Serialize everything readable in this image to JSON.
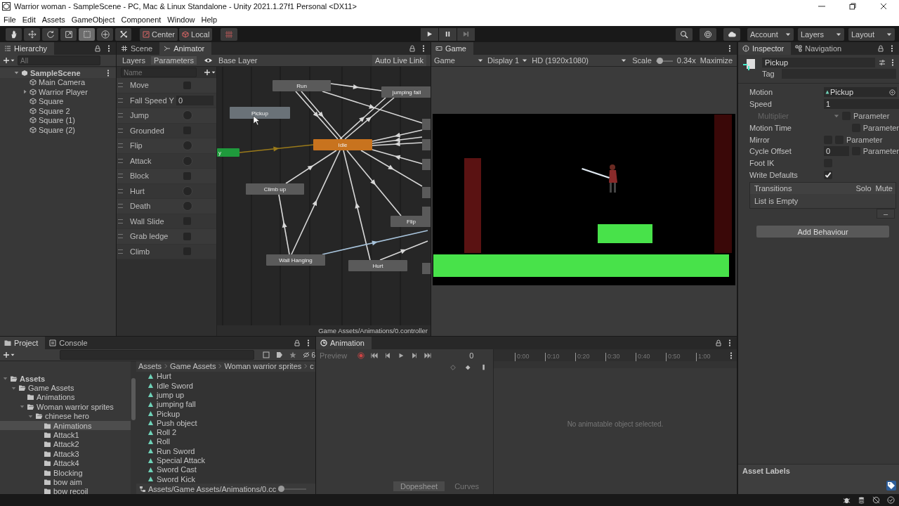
{
  "window": {
    "title": "Warrior woman - SampleScene - PC, Mac & Linux Standalone - Unity 2021.1.27f1 Personal <DX11>"
  },
  "menu": [
    "File",
    "Edit",
    "Assets",
    "GameObject",
    "Component",
    "Window",
    "Help"
  ],
  "toolbar": {
    "tools": [
      {
        "kind": "hand",
        "selected": false
      },
      {
        "kind": "move",
        "selected": false
      },
      {
        "kind": "rotate",
        "selected": false
      },
      {
        "kind": "scale",
        "selected": false
      },
      {
        "kind": "rect",
        "selected": true
      },
      {
        "kind": "transform",
        "selected": false
      },
      {
        "kind": "custom",
        "selected": false
      }
    ],
    "pivot": [
      "Center",
      "Local"
    ],
    "menus": [
      "Account",
      "Layers",
      "Layout"
    ]
  },
  "hierarchy": {
    "tab": "Hierarchy",
    "search": {
      "placeholder": "All"
    },
    "tree": [
      {
        "label": "SampleScene",
        "kind": "scene",
        "expanded": true,
        "children": [
          {
            "label": "Main Camera",
            "kind": "object"
          },
          {
            "label": "Warrior Player",
            "kind": "object",
            "expanded": false
          },
          {
            "label": "Square",
            "kind": "object"
          },
          {
            "label": "Square 2",
            "kind": "object"
          },
          {
            "label": "Square (1)",
            "kind": "object"
          },
          {
            "label": "Square (2)",
            "kind": "object"
          }
        ]
      }
    ]
  },
  "animator": {
    "tabs": [
      {
        "label": "Scene",
        "kind": "scene",
        "selected": false
      },
      {
        "label": "Animator",
        "kind": "animator",
        "selected": true
      }
    ],
    "view_tabs": [
      {
        "label": "Layers",
        "selected": false
      },
      {
        "label": "Parameters",
        "selected": true
      }
    ],
    "layer": "Base Layer",
    "live_link": "Auto Live Link",
    "search": {
      "placeholder": "Name"
    },
    "parameters": [
      {
        "name": "Move",
        "kind": "bool",
        "checked": false
      },
      {
        "name": "Fall Speed Y",
        "kind": "float",
        "value": "0"
      },
      {
        "name": "Jump",
        "kind": "trigger",
        "on": false
      },
      {
        "name": "Grounded",
        "kind": "bool",
        "checked": false
      },
      {
        "name": "Flip",
        "kind": "trigger",
        "on": false
      },
      {
        "name": "Attack",
        "kind": "trigger",
        "on": false
      },
      {
        "name": "Block",
        "kind": "bool",
        "checked": false
      },
      {
        "name": "Hurt",
        "kind": "trigger",
        "on": false
      },
      {
        "name": "Death",
        "kind": "trigger",
        "on": false
      },
      {
        "name": "Wall Slide",
        "kind": "bool",
        "checked": false
      },
      {
        "name": "Grab ledge",
        "kind": "bool",
        "checked": false
      },
      {
        "name": "Climb",
        "kind": "bool",
        "checked": false
      }
    ],
    "states": [
      {
        "label": "Run",
        "kind": "state"
      },
      {
        "label": "jumping fall",
        "kind": "state"
      },
      {
        "label": "Pickup",
        "kind": "selected"
      },
      {
        "label": "Idle",
        "kind": "default"
      },
      {
        "label": "y",
        "kind": "entry"
      },
      {
        "label": "Climb up",
        "kind": "state"
      },
      {
        "label": "Wall Hanging",
        "kind": "state"
      },
      {
        "label": "Hurt",
        "kind": "state"
      },
      {
        "label": "Flip",
        "kind": "state"
      }
    ],
    "footer": "Game Assets/Animations/0.controller"
  },
  "game": {
    "tab": "Game",
    "view": "Game",
    "display": "Display 1",
    "resolution": "HD (1920x1080)",
    "scale_label": "Scale",
    "scale": {
      "level": 0.05
    },
    "scale_value": "0.34x",
    "maximize": "Maximize"
  },
  "inspector": {
    "tabs": [
      {
        "label": "Inspector",
        "kind": "info",
        "selected": true
      },
      {
        "label": "Navigation",
        "kind": "nav",
        "selected": false
      }
    ],
    "name": "Pickup",
    "tag_label": "Tag",
    "properties": [
      {
        "label": "Motion",
        "kind": "object",
        "value": "Pickup",
        "disabled": false
      },
      {
        "label": "Speed",
        "kind": "text",
        "value": "1",
        "disabled": false
      },
      {
        "label": "Multiplier",
        "kind": "dropdown",
        "disabled": true,
        "param": {
          "label": "Parameter",
          "checked": false
        }
      },
      {
        "label": "Motion Time",
        "kind": "none",
        "disabled": false,
        "param": {
          "label": "Parameter",
          "checked": false
        }
      },
      {
        "label": "Mirror",
        "kind": "checkbox",
        "checked": false,
        "disabled": false,
        "param": {
          "label": "Parameter",
          "checked": false
        }
      },
      {
        "label": "Cycle Offset",
        "kind": "text",
        "value": "0",
        "disabled": false,
        "param": {
          "label": "Parameter",
          "checked": false
        }
      },
      {
        "label": "Foot IK",
        "kind": "checkbox",
        "checked": false,
        "disabled": false
      },
      {
        "label": "Write Defaults",
        "kind": "checkbox",
        "checked": true,
        "disabled": false
      }
    ],
    "transitions": {
      "title": "Transitions",
      "columns": [
        "Solo",
        "Mute"
      ],
      "empty": "List is Empty",
      "remove": "–"
    },
    "add_button": "Add Behaviour",
    "asset_labels": "Asset Labels"
  },
  "project": {
    "tabs": [
      {
        "label": "Project",
        "kind": "project",
        "selected": true
      },
      {
        "label": "Console",
        "kind": "console",
        "selected": false
      }
    ],
    "hidden_count": "6",
    "tree": [
      {
        "label": "Assets",
        "selected": false,
        "expanded": true,
        "children": [
          {
            "label": "Game Assets",
            "selected": false,
            "expanded": true,
            "children": [
              {
                "label": "Animations",
                "selected": false
              },
              {
                "label": "Woman warrior sprites",
                "selected": false,
                "expanded": true,
                "children": [
                  {
                    "label": "chinese hero",
                    "selected": false,
                    "expanded": true,
                    "children": [
                      {
                        "label": "Animations",
                        "selected": true
                      },
                      {
                        "label": "Attack1",
                        "selected": false
                      },
                      {
                        "label": "Attack2",
                        "selected": false
                      },
                      {
                        "label": "Attack3",
                        "selected": false
                      },
                      {
                        "label": "Attack4",
                        "selected": false
                      },
                      {
                        "label": "Blocking",
                        "selected": false
                      },
                      {
                        "label": "bow aim",
                        "selected": false
                      },
                      {
                        "label": "bow recoil",
                        "selected": false
                      }
                    ]
                  }
                ]
              }
            ]
          }
        ]
      }
    ],
    "breadcrumb": [
      "Assets",
      "Game Assets",
      "Woman warrior sprites",
      "c"
    ],
    "files": [
      "Hurt",
      "Idle Sword",
      "jump up",
      "jumping fall",
      "Pickup",
      "Push object",
      "Roll 2",
      "Roll",
      "Run Sword",
      "Special Attack",
      "Sword Cast",
      "Sword Kick"
    ],
    "path": "Assets/Game Assets/Animations/0.cc",
    "icon_size": {
      "level": 0
    }
  },
  "animation": {
    "tab": "Animation",
    "preview": "Preview",
    "frame": "0",
    "ticks": [
      "0:00",
      "0:10",
      "0:20",
      "0:30",
      "0:40",
      "0:50",
      "1:00"
    ],
    "message": "No animatable object selected.",
    "view_tabs": [
      {
        "label": "Dopesheet",
        "selected": true
      },
      {
        "label": "Curves",
        "selected": false
      }
    ]
  }
}
